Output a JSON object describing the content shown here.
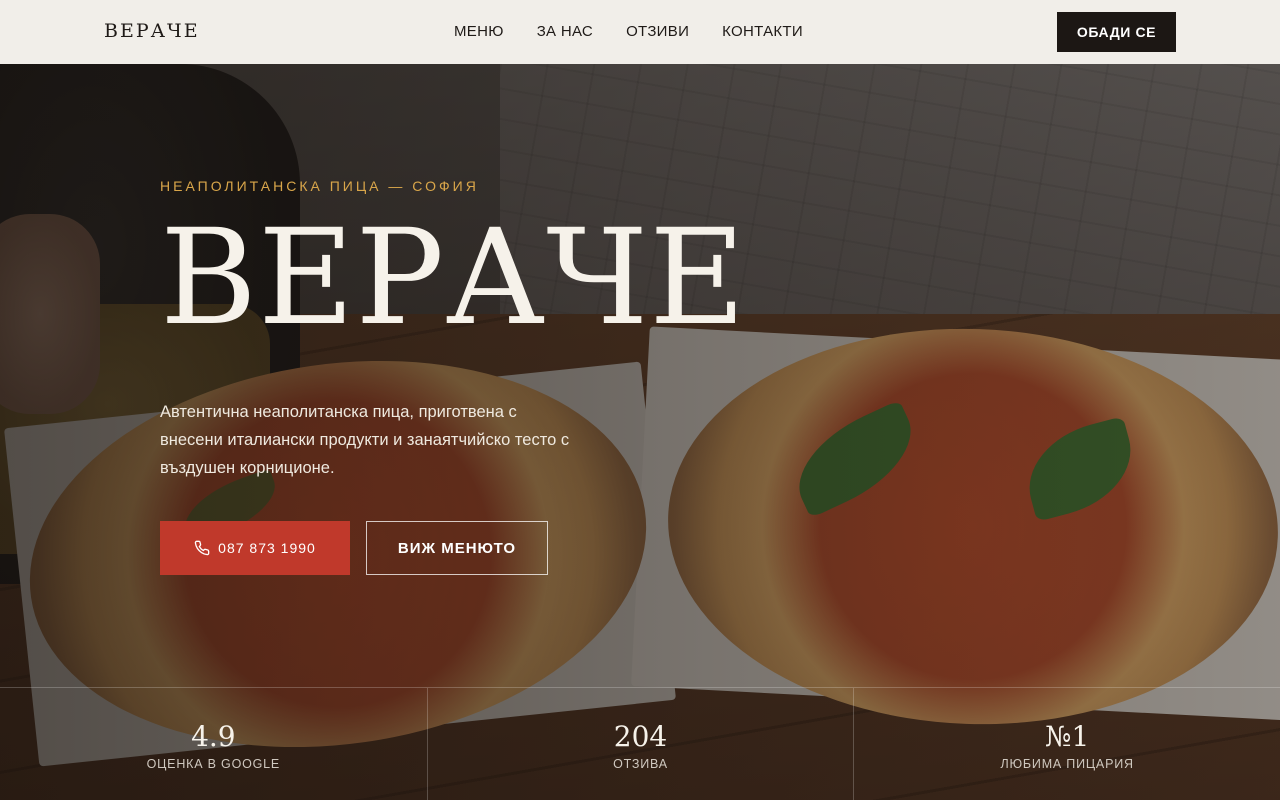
{
  "header": {
    "logo": "ВЕРАЧЕ",
    "nav": [
      "МЕНЮ",
      "ЗА НАС",
      "ОТЗИВИ",
      "КОНТАКТИ"
    ],
    "cta": "ОБАДИ СЕ"
  },
  "hero": {
    "eyebrow": "НЕАПОЛИТАНСКА ПИЦА — СОФИЯ",
    "title": "ВЕРАЧЕ",
    "description": "Автентична неаполитанска пица, приготвена с внесени италиански продукти и занаятчийско тесто с въздушен корниционе.",
    "phone_button": "087 873 1990",
    "menu_button": "ВИЖ МЕНЮТО"
  },
  "stats": [
    {
      "value": "4.9",
      "label": "ОЦЕНКА В GOOGLE"
    },
    {
      "value": "204",
      "label": "ОТЗИВА"
    },
    {
      "value": "№1",
      "label": "ЛЮБИМА ПИЦАРИЯ"
    }
  ],
  "colors": {
    "accent": "#c0392b",
    "gold": "#d9a64a",
    "header_bg": "#f1eee9",
    "dark": "#1c1714"
  }
}
